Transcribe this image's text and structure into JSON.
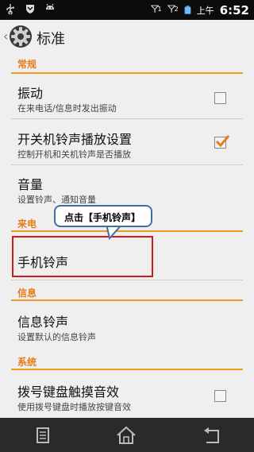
{
  "status_bar": {
    "signal1_label": "1",
    "signal2_label": "2",
    "ampm": "上午",
    "time": "6:52"
  },
  "action_bar": {
    "title": "标准"
  },
  "categories": {
    "general": "常规",
    "incoming": "来电",
    "message": "信息",
    "system": "系统"
  },
  "prefs": {
    "vibrate": {
      "title": "振动",
      "summary": "在来电话/信息时发出振动",
      "checked": false
    },
    "boot_sound": {
      "title": "开关机铃声播放设置",
      "summary": "控制开机和关机铃声是否播放",
      "checked": true
    },
    "volume": {
      "title": "音量",
      "summary": "设置铃声、通知音量"
    },
    "ringtone": {
      "title": "手机铃声"
    },
    "msg_tone": {
      "title": "信息铃声",
      "summary": "设置默认的信息铃声"
    },
    "dialpad": {
      "title": "拨号键盘触摸音效",
      "summary": "使用拨号键盘时播放按键音效",
      "checked": false
    }
  },
  "callout": {
    "text": "点击【手机铃声】"
  },
  "colors": {
    "accent": "#e57e1a",
    "highlight": "#d21a1a",
    "callout_border": "#3e6ea6"
  }
}
